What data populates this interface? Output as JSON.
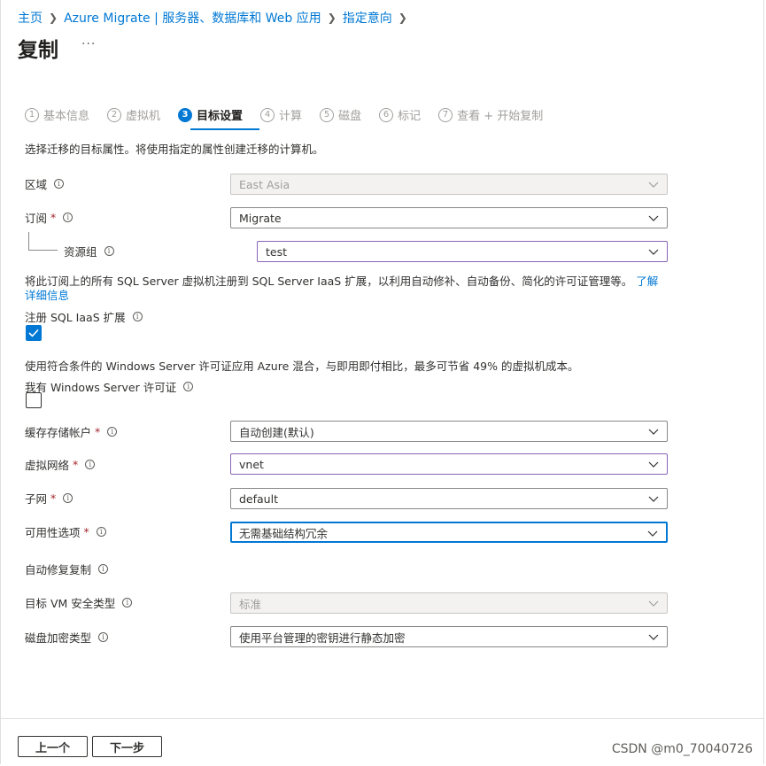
{
  "breadcrumb": [
    "主页",
    "Azure Migrate | 服务器、数据库和 Web 应用",
    "指定意向"
  ],
  "page": {
    "title": "复制",
    "more": "···"
  },
  "steps": [
    {
      "num": "1",
      "label": "基本信息"
    },
    {
      "num": "2",
      "label": "虚拟机"
    },
    {
      "num": "3",
      "label": "目标设置"
    },
    {
      "num": "4",
      "label": "计算"
    },
    {
      "num": "5",
      "label": "磁盘"
    },
    {
      "num": "6",
      "label": "标记"
    },
    {
      "num": "7",
      "label": "查看 + 开始复制"
    }
  ],
  "intro": "选择迁移的目标属性。将使用指定的属性创建迁移的计算机。",
  "fields": {
    "region": {
      "label": "区域",
      "value": "East Asia"
    },
    "subscription": {
      "label": "订阅",
      "value": "Migrate"
    },
    "resource_group": {
      "label": "资源组",
      "value": "test"
    },
    "sql_note": "将此订阅上的所有 SQL Server 虚拟机注册到 SQL Server IaaS 扩展，以利用自动修补、自动备份、简化的许可证管理等。",
    "sql_link_a": "了解",
    "sql_link_b": "详细信息",
    "sql_iaas": {
      "label": "注册 SQL IaaS 扩展",
      "checked": true
    },
    "hybrid_note": "使用符合条件的 Windows Server 许可证应用 Azure 混合，与即用即付相比，最多可节省 49% 的虚拟机成本。",
    "license": {
      "label": "我有 Windows Server 许可证",
      "checked": false
    },
    "cache_storage": {
      "label": "缓存存储帐户",
      "value": "自动创建(默认)"
    },
    "vnet": {
      "label": "虚拟网络",
      "value": "vnet"
    },
    "subnet": {
      "label": "子网",
      "value": "default"
    },
    "availability": {
      "label": "可用性选项",
      "value": "无需基础结构冗余"
    },
    "auto_repair": {
      "label": "自动修复复制"
    },
    "vm_security": {
      "label": "目标 VM 安全类型",
      "value": "标准"
    },
    "disk_encryption": {
      "label": "磁盘加密类型",
      "value": "使用平台管理的密钥进行静态加密"
    }
  },
  "required_mark": "*",
  "info_glyph": "i",
  "buttons": {
    "prev": "上一个",
    "next": "下一步"
  },
  "watermark": "CSDN @m0_70040726",
  "colors": {
    "accent": "#0078d4",
    "required": "#a4262c",
    "focus_purple": "#8764b8"
  }
}
